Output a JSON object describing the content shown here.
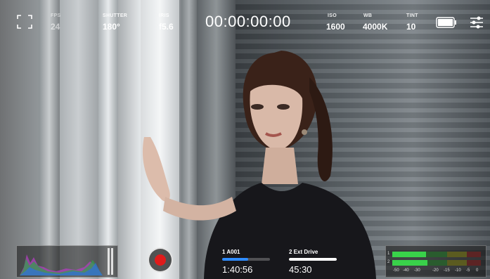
{
  "top_bar": {
    "fps_label": "FPS",
    "fps_value": "24",
    "shutter_label": "SHUTTER",
    "shutter_value": "180°",
    "iris_label": "IRIS",
    "iris_value": "f5.6",
    "timecode": "00:00:00:00",
    "iso_label": "ISO",
    "iso_value": "1600",
    "wb_label": "WB",
    "wb_value": "4000K",
    "tint_label": "TINT",
    "tint_value": "10"
  },
  "icons": {
    "focus": "focus-frame-icon",
    "battery": "battery-icon",
    "settings": "settings-sliders-icon",
    "record": "record-icon"
  },
  "media": [
    {
      "slot_label": "1  A001",
      "time": "1:40:56",
      "fill_fraction": 0.55,
      "color": "#2f8cff"
    },
    {
      "slot_label": "2  Ext Drive",
      "time": "45:30",
      "fill_fraction": 1.0,
      "color": "#ffffff"
    }
  ],
  "audio": {
    "ch1_label": "1",
    "ch2_label": "2",
    "scale": [
      "-50",
      "-40",
      "-30",
      "-20",
      "-15",
      "-10",
      "-5",
      "0"
    ],
    "ch1_level_fraction": 0.38,
    "ch2_level_fraction": 0.4
  },
  "colors": {
    "record": "#e01b1b",
    "card1": "#2f8cff",
    "meter_green": "#39d24a"
  }
}
